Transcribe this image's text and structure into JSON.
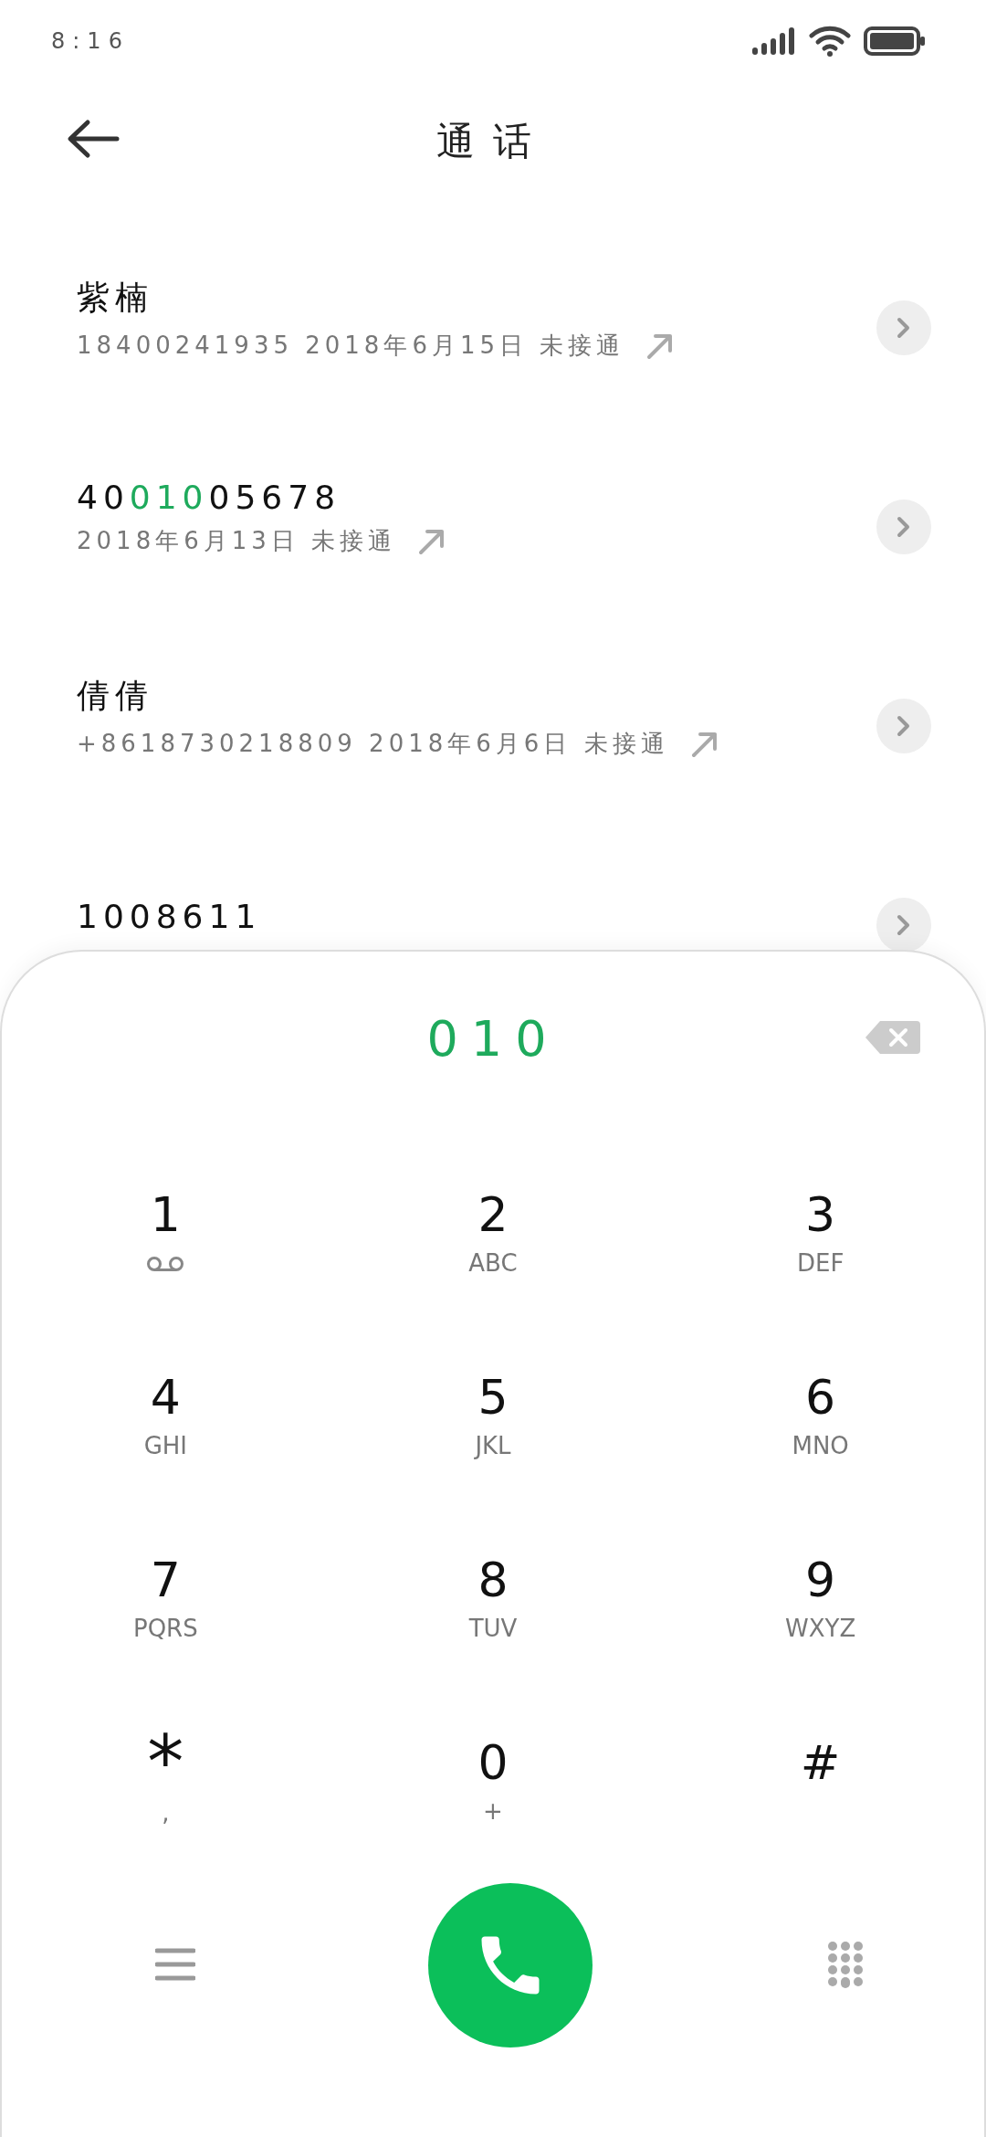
{
  "status_bar": {
    "time": "8:16"
  },
  "header": {
    "title": "通话"
  },
  "calls": [
    {
      "name": [
        {
          "text": "紫楠",
          "match": false
        }
      ],
      "detail": "18400241935 2018年6月15日 未接通"
    },
    {
      "name": [
        {
          "text": "40",
          "match": false
        },
        {
          "text": "010",
          "match": true
        },
        {
          "text": "05678",
          "match": false
        }
      ],
      "detail": "2018年6月13日 未接通"
    },
    {
      "name": [
        {
          "text": "倩倩",
          "match": false
        }
      ],
      "detail": "+8618730218809 2018年6月6日 未接通"
    },
    {
      "name": [
        {
          "text": "1008611",
          "match": false
        }
      ]
    }
  ],
  "dialpad": {
    "input": "010",
    "keys": [
      {
        "digit": "1",
        "kind": "voicemail"
      },
      {
        "digit": "2",
        "sub": "ABC"
      },
      {
        "digit": "3",
        "sub": "DEF"
      },
      {
        "digit": "4",
        "sub": "GHI"
      },
      {
        "digit": "5",
        "sub": "JKL"
      },
      {
        "digit": "6",
        "sub": "MNO"
      },
      {
        "digit": "7",
        "sub": "PQRS"
      },
      {
        "digit": "8",
        "sub": "TUV"
      },
      {
        "digit": "9",
        "sub": "WXYZ"
      },
      {
        "digit": "*",
        "sub": ","
      },
      {
        "digit": "0",
        "sub": "+"
      },
      {
        "digit": "#"
      }
    ]
  }
}
